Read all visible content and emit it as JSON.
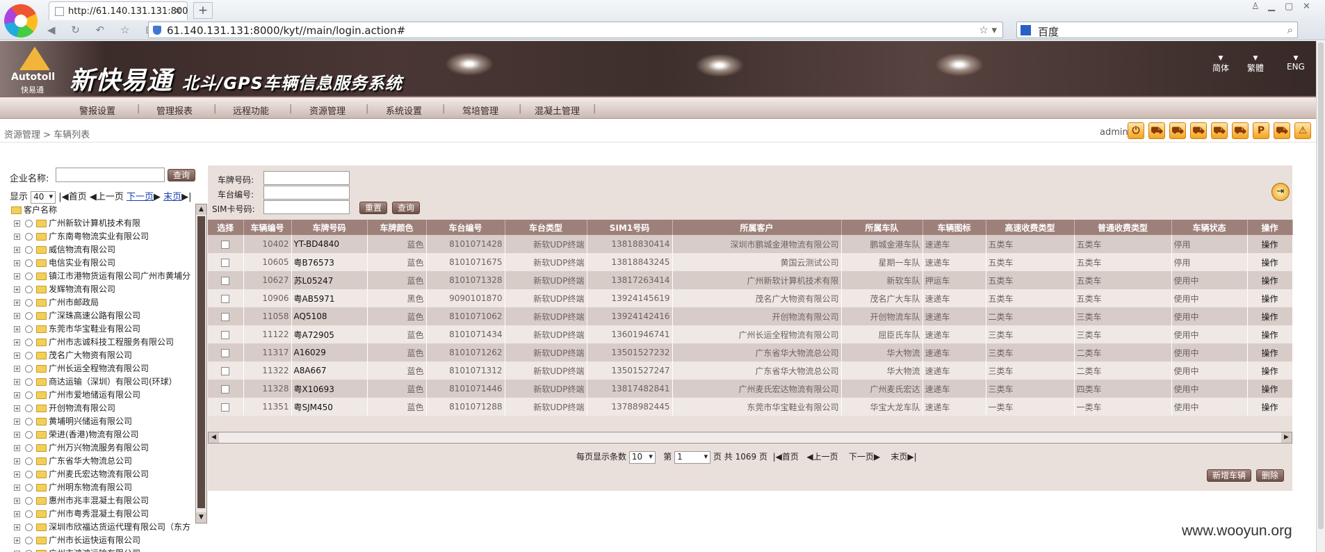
{
  "browser": {
    "tab_title": "http://61.140.131.131:800",
    "tab_close": "×",
    "new_tab": "+",
    "url": "61.140.131.131:8000/kyt//main/login.action#",
    "search_engine": "百度",
    "nav_glyphs": "◀ ↻ ↶ ☆ ⊞"
  },
  "header": {
    "logo_text": "Autotoll",
    "logo_cn": "快易通",
    "title_main": "新快易通",
    "title_sub": "北斗/GPS车辆信息服务系统",
    "languages": [
      "简体",
      "繁體",
      "ENG"
    ]
  },
  "menu": [
    "警报设置",
    "管理报表",
    "远程功能",
    "资源管理",
    "系统设置",
    "驾培管理",
    "混凝土管理"
  ],
  "breadcrumb": "资源管理 > 车辆列表",
  "user": "admin",
  "toolbar_icons": [
    "power-icon",
    "car-icon",
    "car-icon",
    "car-icon",
    "car-icon",
    "car-icon",
    "parking-icon",
    "car-icon",
    "warning-icon"
  ],
  "left": {
    "company_label": "企业名称:",
    "query_button": "查询",
    "show_label": "显示",
    "page_size": "40",
    "first": "首页",
    "prev": "上一页",
    "next": "下一页",
    "last": "末页",
    "tree_root": "客户名称",
    "customers": [
      "广州新软计算机技术有限",
      "广东南粤物流实业有限公司",
      "威信物流有限公司",
      "电信实业有限公司",
      "镇江市港物货运有限公司广州市黄埔分",
      "发辉物流有限公司",
      "广州市邮政局",
      "广深珠高速公路有限公司",
      "东莞市华宝鞋业有限公司",
      "广州市志诚科技工程服务有限公司",
      "茂名广大物资有限公司",
      "广州长运全程物流有限公司",
      "商达运输（深圳）有限公司(环球）",
      "广州市爱地储运有限公司",
      "开创物流有限公司",
      "黄埔明兴储运有限公司",
      "荣进(香港)物流有限公司",
      "广州万兴物流服务有限公司",
      "广东省华大物流总公司",
      "广州麦氏宏达物流有限公司",
      "广州明东物流有限公司",
      "惠州市兆丰混凝土有限公司",
      "广州市粤秀混凝土有限公司",
      "深圳市欣福达货运代理有限公司（东方",
      "广州市长运快运有限公司",
      "广州市鸿鸿运输有限公司"
    ]
  },
  "filters": {
    "plate_label": "车牌号码:",
    "chassis_label": "车台编号:",
    "sim_label": "SIM卡号码:",
    "reset_button": "重置",
    "query_button": "查询"
  },
  "table": {
    "headers": [
      "选择",
      "车辆编号",
      "车牌号码",
      "车牌颜色",
      "车台编号",
      "车台类型",
      "SIM1号码",
      "所属客户",
      "所属车队",
      "车辆图标",
      "高速收费类型",
      "普通收费类型",
      "车辆状态",
      "操作"
    ],
    "rows": [
      [
        "",
        "10402",
        "YT-BD4840",
        "蓝色",
        "8101071428",
        "新软UDP终端",
        "13818830414",
        "深圳市鹏城金港物流有限公司",
        "鹏城金港车队",
        "速递车",
        "五类车",
        "五类车",
        "停用",
        "操作"
      ],
      [
        "",
        "10605",
        "粤B76573",
        "蓝色",
        "8101071675",
        "新软UDP终端",
        "13818843245",
        "黄国云测试公司",
        "星期一车队",
        "速递车",
        "五类车",
        "五类车",
        "停用",
        "操作"
      ],
      [
        "",
        "10627",
        "苏L05247",
        "蓝色",
        "8101071328",
        "新软UDP终端",
        "13817263414",
        "广州新软计算机技术有限",
        "新软车队",
        "押运车",
        "五类车",
        "五类车",
        "使用中",
        "操作"
      ],
      [
        "",
        "10906",
        "粤AB5971",
        "黑色",
        "9090101870",
        "新软UDP终端",
        "13924145619",
        "茂名广大物资有限公司",
        "茂名广大车队",
        "速递车",
        "五类车",
        "五类车",
        "使用中",
        "操作"
      ],
      [
        "",
        "11058",
        "AQ5108",
        "蓝色",
        "8101071062",
        "新软UDP终端",
        "13924142416",
        "开创物流有限公司",
        "开创物流车队",
        "速递车",
        "二类车",
        "三类车",
        "使用中",
        "操作"
      ],
      [
        "",
        "11122",
        "粤A72905",
        "蓝色",
        "8101071434",
        "新软UDP终端",
        "13601946741",
        "广州长运全程物流有限公司",
        "屈臣氏车队",
        "速递车",
        "三类车",
        "三类车",
        "使用中",
        "操作"
      ],
      [
        "",
        "11317",
        "A16029",
        "蓝色",
        "8101071262",
        "新软UDP终端",
        "13501527232",
        "广东省华大物流总公司",
        "华大物流",
        "速递车",
        "三类车",
        "二类车",
        "使用中",
        "操作"
      ],
      [
        "",
        "11322",
        "A8A667",
        "蓝色",
        "8101071312",
        "新软UDP终端",
        "13501527247",
        "广东省华大物流总公司",
        "华大物流",
        "速递车",
        "三类车",
        "二类车",
        "使用中",
        "操作"
      ],
      [
        "",
        "11328",
        "粤X10693",
        "蓝色",
        "8101071446",
        "新软UDP终端",
        "13817482841",
        "广州麦氏宏达物流有限公司",
        "广州麦氏宏达",
        "速递车",
        "三类车",
        "四类车",
        "使用中",
        "操作"
      ],
      [
        "",
        "11351",
        "粤SJM450",
        "蓝色",
        "8101071288",
        "新软UDP终端",
        "13788982445",
        "东莞市华宝鞋业有限公司",
        "华宝大龙车队",
        "速递车",
        "一类车",
        "一类车",
        "使用中",
        "操作"
      ]
    ]
  },
  "pager": {
    "per_page_label": "每页显示条数",
    "per_page": "10",
    "page_prefix": "第",
    "page": "1",
    "page_total": "页 共 1069 页",
    "first": "首页",
    "prev": "上一页",
    "next": "下一页",
    "last": "末页"
  },
  "actions": {
    "add": "新增车辆",
    "delete": "删除"
  },
  "watermark": "www.wooyun.org"
}
